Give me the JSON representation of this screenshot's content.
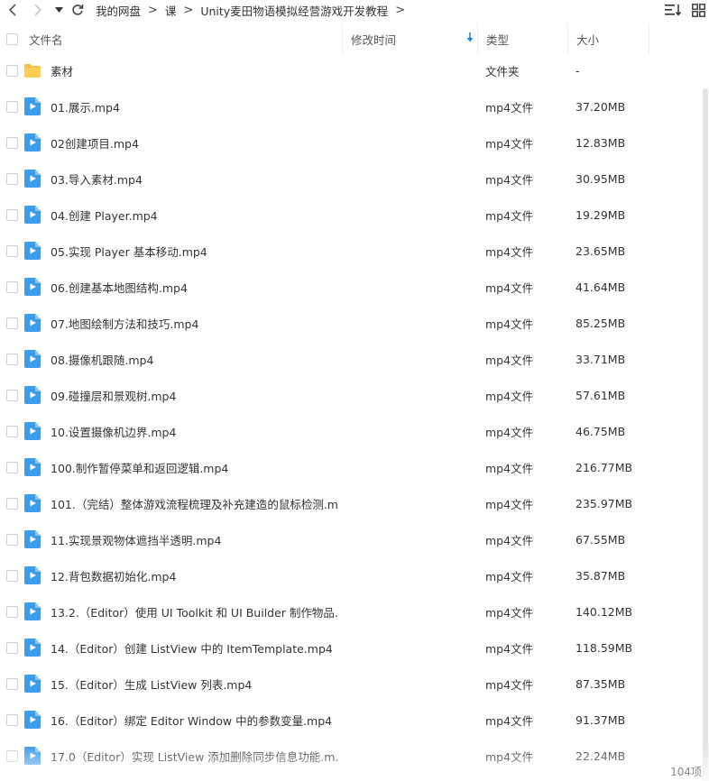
{
  "breadcrumb": [
    "我的网盘",
    "课",
    "Unity麦田物语模拟经营游戏开发教程"
  ],
  "breadcrumb_separator": ">",
  "columns": {
    "name": "文件名",
    "date": "修改时间",
    "type": "类型",
    "size": "大小"
  },
  "sort": {
    "column": "date",
    "direction": "desc"
  },
  "colors": {
    "accent": "#1e88e5",
    "folder": "#f7c144",
    "video": "#3d9bea"
  },
  "files": [
    {
      "name": "素材",
      "icon": "folder-icon",
      "type": "文件夹",
      "size": "-"
    },
    {
      "name": "01.展示.mp4",
      "icon": "video-file-icon",
      "type": "mp4文件",
      "size": "37.20MB"
    },
    {
      "name": "02创建项目.mp4",
      "icon": "video-file-icon",
      "type": "mp4文件",
      "size": "12.83MB"
    },
    {
      "name": "03.导入素材.mp4",
      "icon": "video-file-icon",
      "type": "mp4文件",
      "size": "30.95MB"
    },
    {
      "name": "04.创建 Player.mp4",
      "icon": "video-file-icon",
      "type": "mp4文件",
      "size": "19.29MB"
    },
    {
      "name": "05.实现 Player 基本移动.mp4",
      "icon": "video-file-icon",
      "type": "mp4文件",
      "size": "23.65MB"
    },
    {
      "name": "06.创建基本地图结构.mp4",
      "icon": "video-file-icon",
      "type": "mp4文件",
      "size": "41.64MB"
    },
    {
      "name": "07.地图绘制方法和技巧.mp4",
      "icon": "video-file-icon",
      "type": "mp4文件",
      "size": "85.25MB"
    },
    {
      "name": "08.摄像机跟随.mp4",
      "icon": "video-file-icon",
      "type": "mp4文件",
      "size": "33.71MB"
    },
    {
      "name": "09.碰撞层和景观树.mp4",
      "icon": "video-file-icon",
      "type": "mp4文件",
      "size": "57.61MB"
    },
    {
      "name": "10.设置摄像机边界.mp4",
      "icon": "video-file-icon",
      "type": "mp4文件",
      "size": "46.75MB"
    },
    {
      "name": "100.制作暂停菜单和返回逻辑.mp4",
      "icon": "video-file-icon",
      "type": "mp4文件",
      "size": "216.77MB"
    },
    {
      "name": "101.（完结）整体游戏流程梳理及补充建造的鼠标检测.m...",
      "icon": "video-file-icon",
      "type": "mp4文件",
      "size": "235.97MB"
    },
    {
      "name": "11.实现景观物体遮挡半透明.mp4",
      "icon": "video-file-icon",
      "type": "mp4文件",
      "size": "67.55MB"
    },
    {
      "name": "12.背包数据初始化.mp4",
      "icon": "video-file-icon",
      "type": "mp4文件",
      "size": "35.87MB"
    },
    {
      "name": "13.2.（Editor）使用 UI Toolkit 和 UI Builder 制作物品...",
      "icon": "video-file-icon",
      "type": "mp4文件",
      "size": "140.12MB"
    },
    {
      "name": "14.（Editor）创建 ListView 中的 ItemTemplate.mp4",
      "icon": "video-file-icon",
      "type": "mp4文件",
      "size": "118.59MB"
    },
    {
      "name": "15.（Editor）生成 ListView 列表.mp4",
      "icon": "video-file-icon",
      "type": "mp4文件",
      "size": "87.35MB"
    },
    {
      "name": "16.（Editor）绑定 Editor Window 中的参数变量.mp4",
      "icon": "video-file-icon",
      "type": "mp4文件",
      "size": "91.37MB"
    },
    {
      "name": "17.0（Editor）实现 ListView 添加删除同步信息功能.m...",
      "icon": "video-file-icon",
      "type": "mp4文件",
      "size": "22.24MB"
    }
  ],
  "status": {
    "count": "104项"
  }
}
